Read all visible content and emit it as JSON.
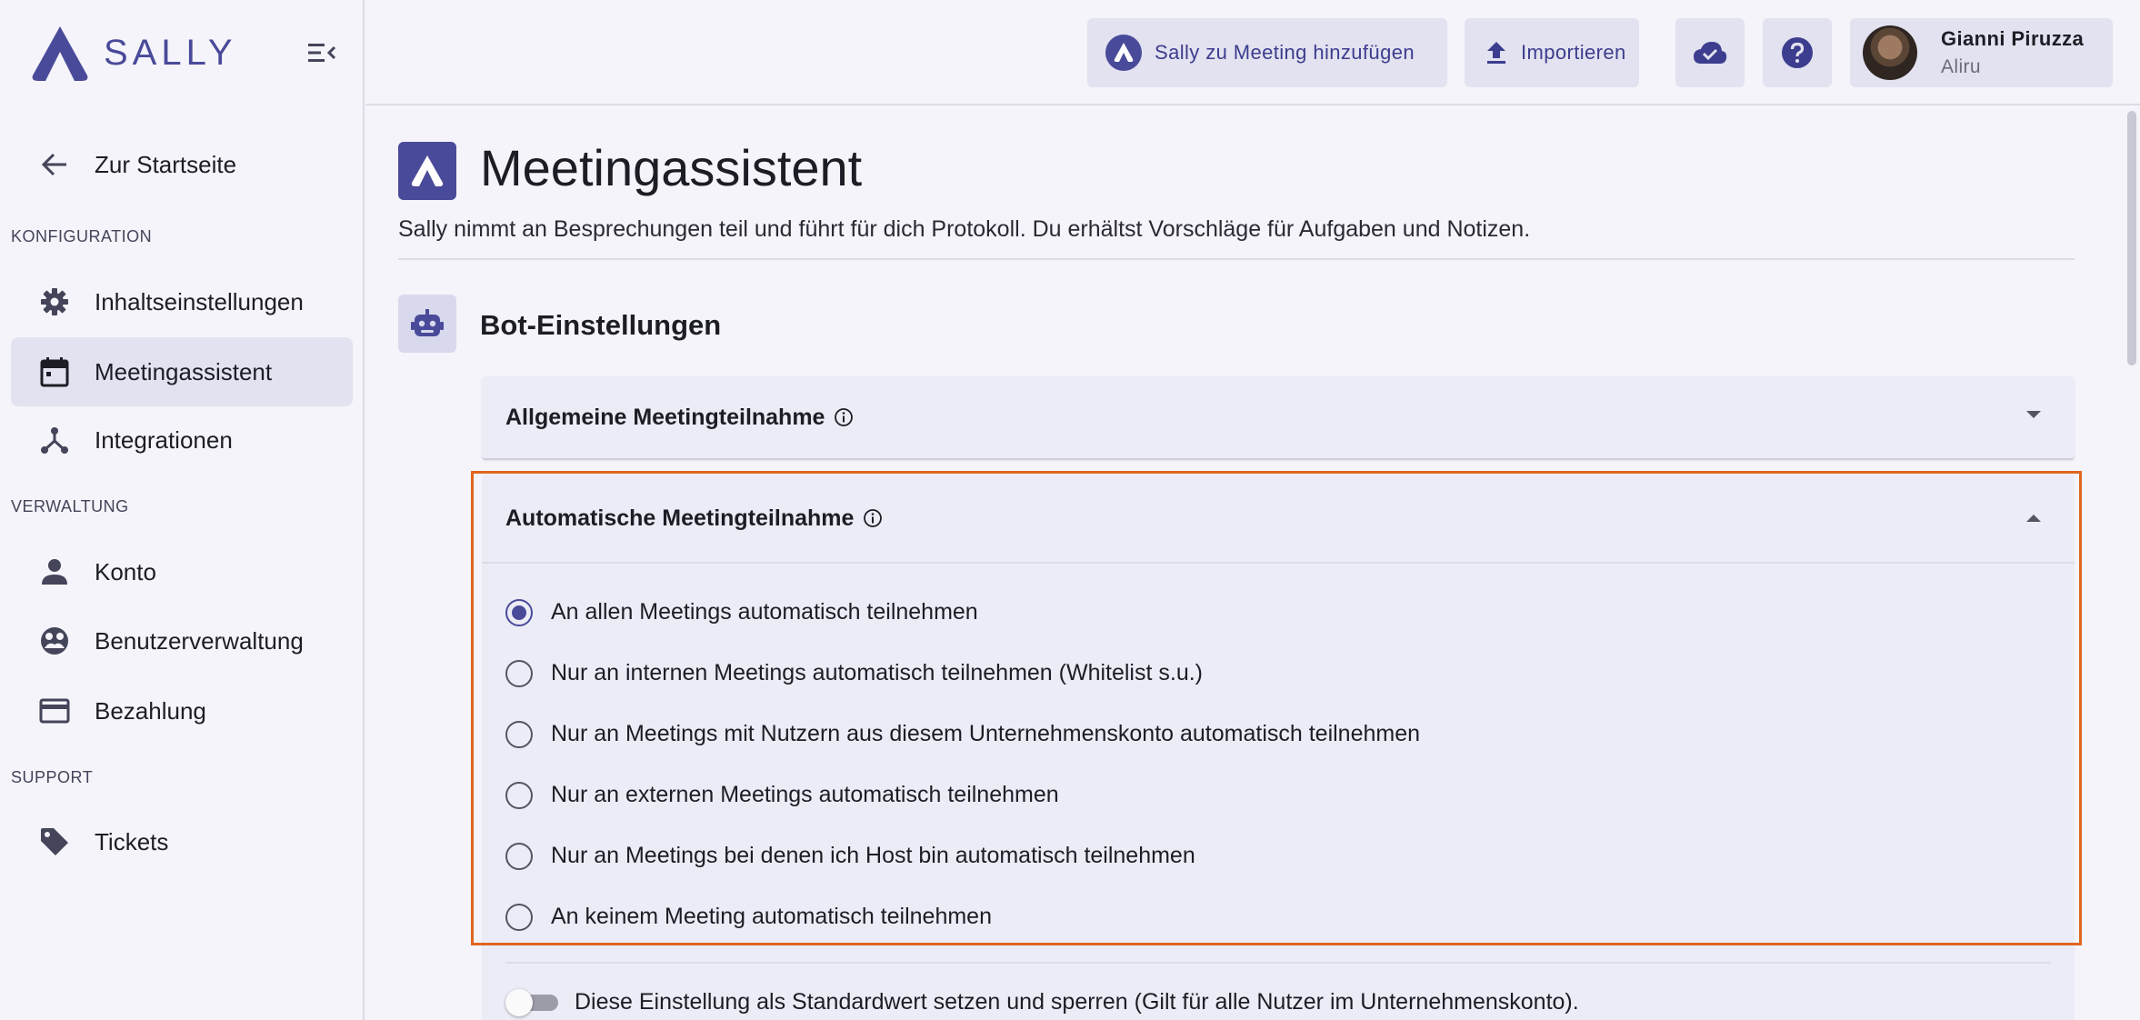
{
  "brand": {
    "name": "SALLY",
    "color": "#4a4a9a"
  },
  "sidebar": {
    "back_label": "Zur Startseite",
    "sections": [
      {
        "label": "KONFIGURATION"
      },
      {
        "label": "VERWALTUNG"
      },
      {
        "label": "SUPPORT"
      }
    ],
    "items": [
      {
        "label": "Inhaltseinstellungen",
        "icon": "gear-icon"
      },
      {
        "label": "Meetingassistent",
        "icon": "calendar-icon",
        "active": true
      },
      {
        "label": "Integrationen",
        "icon": "integrations-icon"
      },
      {
        "label": "Konto",
        "icon": "person-icon"
      },
      {
        "label": "Benutzerverwaltung",
        "icon": "users-icon"
      },
      {
        "label": "Bezahlung",
        "icon": "credit-card-icon"
      },
      {
        "label": "Tickets",
        "icon": "tag-icon"
      }
    ]
  },
  "topbar": {
    "add_to_meeting_label": "Sally zu Meeting hinzufügen",
    "import_label": "Importieren",
    "user": {
      "name": "Gianni Piruzza",
      "org": "Aliru"
    }
  },
  "main": {
    "title": "Meetingassistent",
    "description": "Sally nimmt an Besprechungen teil und führt für dich Protokoll. Du erhältst Vorschläge für Aufgaben und Notizen.",
    "section_title": "Bot-Einstellungen",
    "panels": [
      {
        "title": "Allgemeine Meetingteilnahme",
        "expanded": false
      },
      {
        "title": "Automatische Meetingteilnahme",
        "expanded": true
      }
    ],
    "auto_join_options": [
      {
        "label": "An allen Meetings automatisch teilnehmen",
        "selected": true
      },
      {
        "label": "Nur an internen Meetings automatisch teilnehmen (Whitelist s.u.)",
        "selected": false
      },
      {
        "label": "Nur an Meetings mit Nutzern aus diesem Unternehmenskonto automatisch teilnehmen",
        "selected": false
      },
      {
        "label": "Nur an externen Meetings automatisch teilnehmen",
        "selected": false
      },
      {
        "label": "Nur an Meetings bei denen ich Host bin automatisch teilnehmen",
        "selected": false
      },
      {
        "label": "An keinem Meeting automatisch teilnehmen",
        "selected": false
      }
    ],
    "lock_default_label": "Diese Einstellung als Standardwert setzen und sperren (Gilt für alle Nutzer im Unternehmenskonto).",
    "lock_default_on": false
  },
  "colors": {
    "accent": "#4a4a9a",
    "highlight": "#e0661f",
    "background": "#f4f4fa"
  }
}
